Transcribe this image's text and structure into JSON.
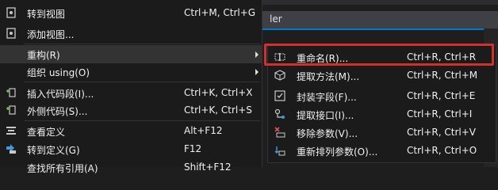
{
  "background": {
    "title_fragment": "ler"
  },
  "menu": {
    "items": [
      {
        "label": "转到视图",
        "shortcut": "Ctrl+M, Ctrl+G",
        "icon": "view-icon"
      },
      {
        "label": "添加视图...",
        "shortcut": "",
        "icon": "add-view-icon"
      },
      {
        "label": "重构(R)",
        "shortcut": "",
        "icon": "",
        "submenu": true
      },
      {
        "label": "组织 using(O)",
        "shortcut": "",
        "icon": "",
        "submenu": true
      },
      {
        "label": "插入代码段(I)...",
        "shortcut": "Ctrl+K, Ctrl+X",
        "icon": "insert-snippet-icon"
      },
      {
        "label": "外侧代码(S)...",
        "shortcut": "Ctrl+K, Ctrl+S",
        "icon": "surround-with-icon"
      },
      {
        "label": "查看定义",
        "shortcut": "Alt+F12",
        "icon": "peek-definition-icon"
      },
      {
        "label": "转到定义(G)",
        "shortcut": "F12",
        "icon": "go-to-definition-icon"
      },
      {
        "label": "查找所有引用(A)",
        "shortcut": "Shift+F12",
        "icon": ""
      }
    ]
  },
  "submenu": {
    "items": [
      {
        "label": "重命名(R)...",
        "shortcut": "Ctrl+R, Ctrl+R",
        "icon": "rename-icon"
      },
      {
        "label": "提取方法(M)...",
        "shortcut": "Ctrl+R, Ctrl+M",
        "icon": "extract-method-icon"
      },
      {
        "label": "封装字段(F)...",
        "shortcut": "Ctrl+R, Ctrl+E",
        "icon": "encapsulate-field-icon"
      },
      {
        "label": "提取接口(I)...",
        "shortcut": "Ctrl+R, Ctrl+I",
        "icon": "extract-interface-icon"
      },
      {
        "label": "移除参数(V)...",
        "shortcut": "Ctrl+R, Ctrl+V",
        "icon": "remove-parameters-icon"
      },
      {
        "label": "重新排列参数(O)...",
        "shortcut": "Ctrl+R, Ctrl+O",
        "icon": "reorder-parameters-icon"
      }
    ]
  },
  "colors": {
    "menu_background": "#1b1b1c",
    "hover_background": "#333334",
    "highlight_border": "#d32f2f",
    "accent": "#007acc"
  }
}
